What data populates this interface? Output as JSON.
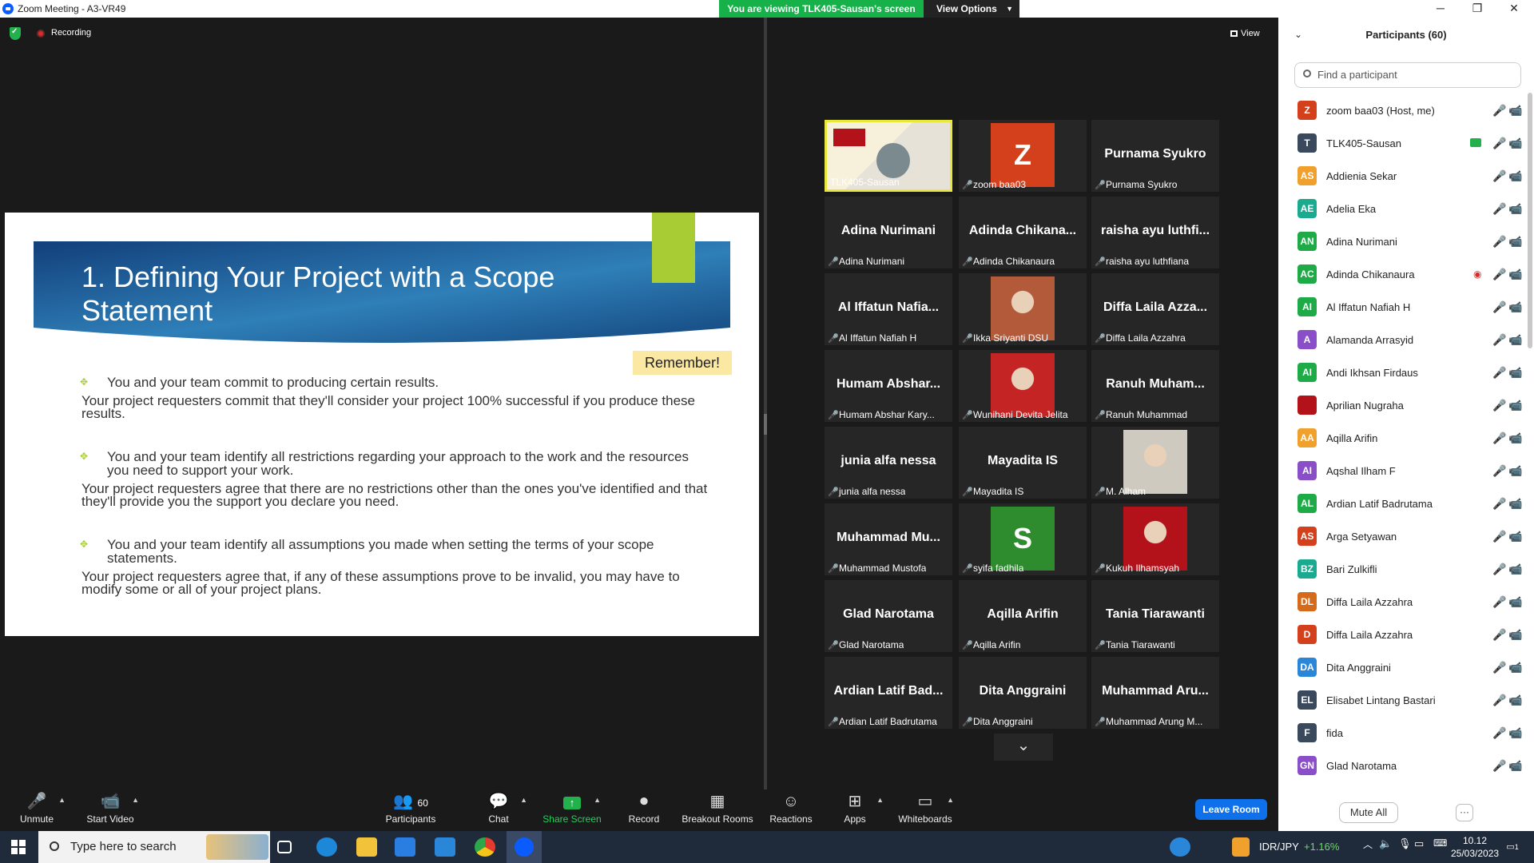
{
  "window": {
    "title": "Zoom Meeting - A3-VR49",
    "viewing_banner": "You are viewing TLK405-Sausan's screen",
    "view_options": "View Options",
    "minimize": "─",
    "maximize": "❐",
    "close": "✕"
  },
  "share": {
    "recording_label": "Recording"
  },
  "slide": {
    "title": "1. Defining Your Project with a Scope Statement",
    "remember": "Remember!",
    "bullets": [
      {
        "text": "You and your team commit to producing certain results.",
        "sub": "Your project requesters commit that they'll consider your project 100% successful if you produce these results."
      },
      {
        "text": "You and your team identify all restrictions regarding your approach to the work and the resources you need to support your work.",
        "sub": "Your project requesters agree that there are no restrictions other than the ones you've identified and that they'll provide you the support you declare you need."
      },
      {
        "text": "You and your team identify all assumptions you made when setting the terms of your scope statements.",
        "sub": "Your project requesters agree that, if any of these assumptions prove to be invalid, you may have to modify some or all of your project plans."
      }
    ],
    "colors": {
      "banner": "#1b4f8a",
      "accent": "#a8cc33",
      "remember": "#fbe9a3"
    }
  },
  "gallery": {
    "view_label": "View",
    "tiles": [
      {
        "big": "",
        "foot": "TLK405-Sausan",
        "muted": false,
        "type": "video"
      },
      {
        "big": "Z",
        "foot": "zoom baa03",
        "muted": true,
        "type": "letter",
        "color": "#d5401c"
      },
      {
        "big": "Purnama Syukro",
        "foot": "Purnama Syukro",
        "muted": true,
        "type": "name"
      },
      {
        "big": "Adina Nurimani",
        "foot": "Adina Nurimani",
        "muted": true,
        "type": "name"
      },
      {
        "big": "Adinda Chikana...",
        "foot": "Adinda Chikanaura",
        "muted": true,
        "type": "name"
      },
      {
        "big": "raisha ayu luthfi...",
        "foot": "raisha ayu luthfiana",
        "muted": true,
        "type": "name"
      },
      {
        "big": "Al Iffatun Nafia...",
        "foot": "Al Iffatun Nafiah H",
        "muted": true,
        "type": "name"
      },
      {
        "big": "",
        "foot": "Ikka Sriyanti DSU",
        "muted": true,
        "type": "photo",
        "color": "#b35a3a"
      },
      {
        "big": "Diffa Laila Azza...",
        "foot": "Diffa Laila Azzahra",
        "muted": true,
        "type": "name"
      },
      {
        "big": "Humam Abshar...",
        "foot": "Humam Abshar Kary...",
        "muted": true,
        "type": "name"
      },
      {
        "big": "",
        "foot": "Wunihani Devita Jelita",
        "muted": true,
        "type": "photo",
        "color": "#c42424"
      },
      {
        "big": "Ranuh Muham...",
        "foot": "Ranuh Muhammad",
        "muted": true,
        "type": "name"
      },
      {
        "big": "junia alfa nessa",
        "foot": "junia alfa nessa",
        "muted": true,
        "type": "name"
      },
      {
        "big": "Mayadita IS",
        "foot": "Mayadita IS",
        "muted": true,
        "type": "name"
      },
      {
        "big": "",
        "foot": "M. Alham",
        "muted": true,
        "type": "photo",
        "color": "#cfcac0"
      },
      {
        "big": "Muhammad Mu...",
        "foot": "Muhammad Mustofa",
        "muted": true,
        "type": "name"
      },
      {
        "big": "S",
        "foot": "syifa fadhila",
        "muted": true,
        "type": "letter",
        "color": "#2e8b2e"
      },
      {
        "big": "",
        "foot": "Kukuh Ilhamsyah",
        "muted": true,
        "type": "photo",
        "color": "#b3121a"
      },
      {
        "big": "Glad Narotama",
        "foot": "Glad Narotama",
        "muted": true,
        "type": "name"
      },
      {
        "big": "Aqilla Arifin",
        "foot": "Aqilla Arifin",
        "muted": true,
        "type": "name"
      },
      {
        "big": "Tania Tiarawanti",
        "foot": "Tania Tiarawanti",
        "muted": true,
        "type": "name"
      },
      {
        "big": "Ardian Latif Bad...",
        "foot": "Ardian Latif Badrutama",
        "muted": true,
        "type": "name"
      },
      {
        "big": "Dita Anggraini",
        "foot": "Dita Anggraini",
        "muted": true,
        "type": "name"
      },
      {
        "big": "Muhammad Aru...",
        "foot": "Muhammad Arung M...",
        "muted": true,
        "type": "name"
      }
    ]
  },
  "participants": {
    "title": "Participants (60)",
    "search_placeholder": "Find a participant",
    "list": [
      {
        "initials": "Z",
        "name": "zoom baa03 (Host, me)",
        "color": "#d5401c"
      },
      {
        "initials": "T",
        "name": "TLK405-Sausan",
        "color": "#3a4a5c",
        "sharing": true
      },
      {
        "initials": "AS",
        "name": "Addienia Sekar",
        "color": "#f0a02c"
      },
      {
        "initials": "AE",
        "name": "Adelia Eka",
        "color": "#1aaa8f"
      },
      {
        "initials": "AN",
        "name": "Adina Nurimani",
        "color": "#1eaa46"
      },
      {
        "initials": "AC",
        "name": "Adinda Chikanaura",
        "color": "#1eaa46",
        "flag": true
      },
      {
        "initials": "AI",
        "name": "Al Iffatun Nafiah H",
        "color": "#1eaa46"
      },
      {
        "initials": "A",
        "name": "Alamanda Arrasyid",
        "color": "#8a4fc8"
      },
      {
        "initials": "AI",
        "name": "Andi Ikhsan Firdaus",
        "color": "#1eaa46"
      },
      {
        "initials": "",
        "name": "Aprilian Nugraha",
        "color": "#b3121a"
      },
      {
        "initials": "AA",
        "name": "Aqilla Arifin",
        "color": "#f0a02c"
      },
      {
        "initials": "AI",
        "name": "Aqshal Ilham F",
        "color": "#8a4fc8"
      },
      {
        "initials": "AL",
        "name": "Ardian Latif Badrutama",
        "color": "#1eaa46"
      },
      {
        "initials": "AS",
        "name": "Arga Setyawan",
        "color": "#d5401c"
      },
      {
        "initials": "BZ",
        "name": "Bari Zulkifli",
        "color": "#1aaa8f"
      },
      {
        "initials": "DL",
        "name": "Diffa Laila Azzahra",
        "color": "#d56a1c"
      },
      {
        "initials": "D",
        "name": "Diffa Laila Azzahra",
        "color": "#d5401c"
      },
      {
        "initials": "DA",
        "name": "Dita Anggraini",
        "color": "#2a86d8"
      },
      {
        "initials": "EL",
        "name": "Elisabet Lintang Bastari",
        "color": "#3a4a5c"
      },
      {
        "initials": "F",
        "name": "fida",
        "color": "#3a4a5c"
      },
      {
        "initials": "GN",
        "name": "Glad Narotama",
        "color": "#8a4fc8"
      }
    ],
    "mute_all": "Mute All",
    "more": "···"
  },
  "toolbar": {
    "participants_count": "60",
    "items": [
      {
        "label": "Unmute",
        "icon": "🎤"
      },
      {
        "label": "Start Video",
        "icon": "📹"
      },
      {
        "label": "Participants",
        "icon": "👥"
      },
      {
        "label": "Chat",
        "icon": "💬"
      },
      {
        "label": "Share Screen",
        "icon": "↑"
      },
      {
        "label": "Record",
        "icon": "⏺"
      },
      {
        "label": "Breakout Rooms",
        "icon": "▦"
      },
      {
        "label": "Reactions",
        "icon": "☺"
      },
      {
        "label": "Apps",
        "icon": "⊞"
      },
      {
        "label": "Whiteboards",
        "icon": "▭"
      }
    ],
    "leave": "Leave Room"
  },
  "taskbar": {
    "search_placeholder": "Type here to search",
    "ticker": "IDR/JPY",
    "ticker_change": "+1.16%",
    "time": "10.12",
    "date": "25/03/2023",
    "notifications": "1"
  }
}
